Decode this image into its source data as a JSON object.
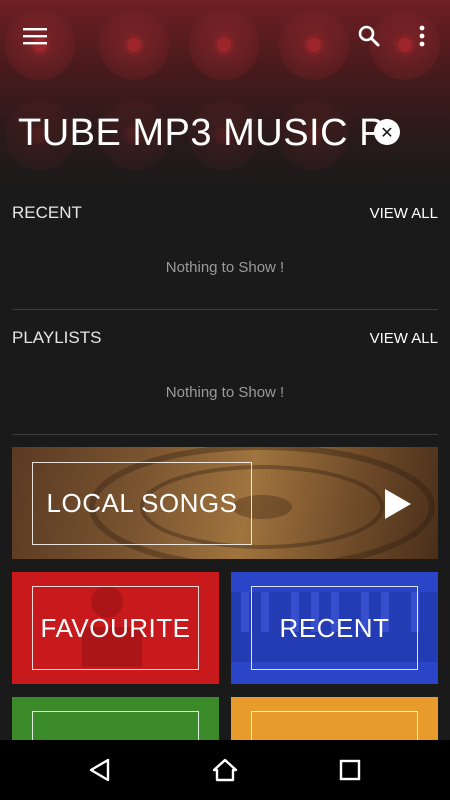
{
  "header": {
    "title": "TUBE MP3 MUSIC PL",
    "menu_icon": "menu-icon",
    "search_icon": "search-icon",
    "more_icon": "more-vert-icon",
    "clear_icon": "close-icon"
  },
  "recent": {
    "title": "RECENT",
    "view_all": "VIEW ALL",
    "empty": "Nothing to Show !"
  },
  "playlists": {
    "title": "PLAYLISTS",
    "view_all": "VIEW ALL",
    "empty": "Nothing to Show !"
  },
  "tiles": {
    "local_songs": "LOCAL SONGS",
    "favourite": "FAVOURITE",
    "recent": "RECENT"
  },
  "colors": {
    "header_red": "#6e1f24",
    "favourite": "#c8191c",
    "recent": "#2a45c8",
    "green": "#3a8a2a",
    "orange": "#e89a2a"
  },
  "navbar": {
    "back_icon": "back-icon",
    "home_icon": "home-icon",
    "recents_icon": "overview-icon"
  }
}
